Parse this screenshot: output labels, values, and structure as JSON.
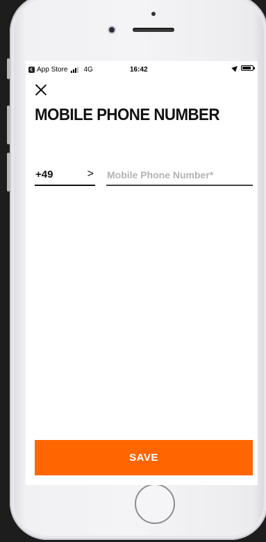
{
  "status_bar": {
    "back_app": "App Store",
    "network": "4G",
    "time": "16:42"
  },
  "screen": {
    "title": "MOBILE PHONE NUMBER",
    "country_code": "+49",
    "chevron": ">",
    "phone_field": {
      "value": "",
      "placeholder": "Mobile Phone Number*"
    },
    "save_label": "SAVE"
  },
  "colors": {
    "accent": "#ff6600",
    "background": "#ffffff",
    "device_frame": "#f1f1f4"
  },
  "icons": [
    "close-icon",
    "chevron-right-icon",
    "signal-icon",
    "location-arrow-icon",
    "battery-icon"
  ]
}
